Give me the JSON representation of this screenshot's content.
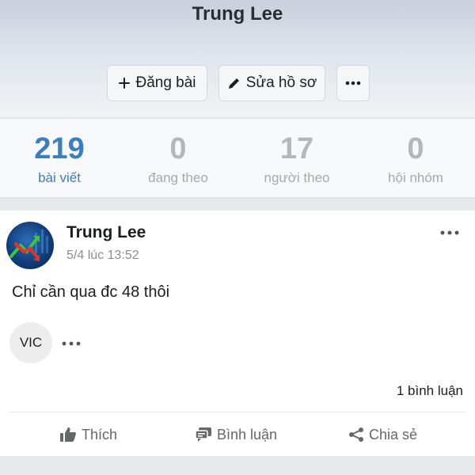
{
  "profile": {
    "name": "Trung Lee"
  },
  "actions": {
    "post_label": "Đăng bài",
    "edit_label": "Sửa hồ sơ"
  },
  "stats": [
    {
      "value": "219",
      "label": "bài viết"
    },
    {
      "value": "0",
      "label": "đang theo"
    },
    {
      "value": "17",
      "label": "người theo"
    },
    {
      "value": "0",
      "label": "hội nhóm"
    }
  ],
  "post": {
    "author": "Trung Lee",
    "time": "5/4 lúc 13:52",
    "text": "Chỉ cần qua đc 48 thôi",
    "tag": "VIC",
    "comment_count": "1 bình luận",
    "like_label": "Thích",
    "comment_label": "Bình luận",
    "share_label": "Chia sẻ"
  },
  "colors": {
    "accent": "#3b7fbf",
    "muted": "#a6a9ae",
    "action_gray": "#65676b"
  },
  "icons": [
    "plus-icon",
    "pencil-icon",
    "more-icon",
    "more-icon",
    "more-icon",
    "thumb-up-icon",
    "comment-icon",
    "share-icon"
  ]
}
